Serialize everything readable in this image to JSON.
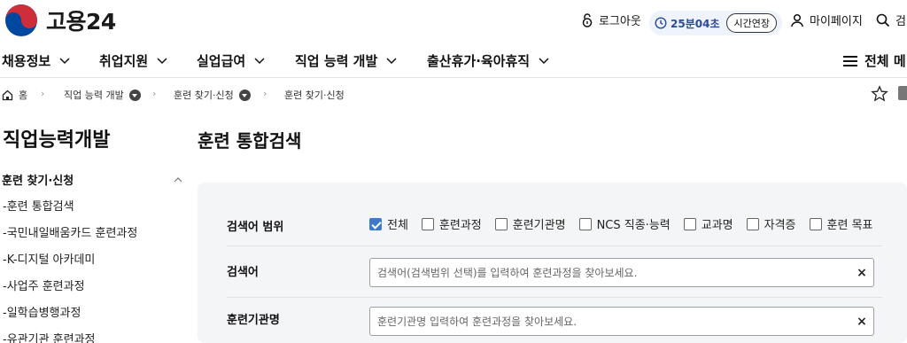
{
  "header": {
    "logo_text": "고용24",
    "logout_label": "로그아웃",
    "timer_value": "25분04초",
    "extend_label": "시간연장",
    "mypage_label": "마이페이지",
    "search_label": "검"
  },
  "gnb": {
    "items": [
      {
        "label": "채용정보"
      },
      {
        "label": "취업지원"
      },
      {
        "label": "실업급여"
      },
      {
        "label": "직업 능력 개발"
      },
      {
        "label": "출산휴가·육아휴직"
      }
    ],
    "all_menu_label": "전체 메"
  },
  "breadcrumb": {
    "home": "홈",
    "level1": "직업 능력 개발",
    "level2": "훈련 찾기·신청",
    "level3": "훈련 찾기·신청"
  },
  "sidebar": {
    "title": "직업능력개발",
    "section_label": "훈련 찾기·신청",
    "items": [
      {
        "label": "-훈련 통합검색"
      },
      {
        "label": "-국민내일배움카드 훈련과정"
      },
      {
        "label": "-K-디지털 아카데미"
      },
      {
        "label": "-사업주 훈련과정"
      },
      {
        "label": "-일학습병행과정"
      },
      {
        "label": "-유관기관 훈련과정"
      }
    ]
  },
  "main": {
    "title": "훈련 통합검색",
    "scope": {
      "label": "검색어 범위",
      "options": [
        {
          "label": "전체",
          "checked": true
        },
        {
          "label": "훈련과정",
          "checked": false
        },
        {
          "label": "훈련기관명",
          "checked": false
        },
        {
          "label": "NCS 직종·능력",
          "checked": false
        },
        {
          "label": "교과명",
          "checked": false
        },
        {
          "label": "자격증",
          "checked": false
        },
        {
          "label": "훈련 목표",
          "checked": false
        }
      ]
    },
    "keyword": {
      "label": "검색어",
      "value": "",
      "placeholder": "검색어(검색범위 선택)를 입력하여 훈련과정을 찾아보세요."
    },
    "institution": {
      "label": "훈련기관명",
      "value": "",
      "placeholder": "훈련기관명 입력하여 훈련과정을 찾아보세요."
    },
    "clear_symbol": "×"
  },
  "colors": {
    "accent": "#3d7ac8",
    "timer_text": "#2a4a9c",
    "timer_bg": "#eef3fc",
    "panel_bg": "#f4f5f7",
    "logo_red": "#cd2e3a",
    "logo_blue": "#0047a0"
  },
  "icons": {
    "logo": "taegeuk-logo-icon",
    "logout": "lock-icon",
    "timer": "clock-icon",
    "mypage": "user-icon",
    "search": "search-icon",
    "menu": "hamburger-icon",
    "home": "home-icon",
    "favorite": "star-icon",
    "print": "print-icon"
  }
}
